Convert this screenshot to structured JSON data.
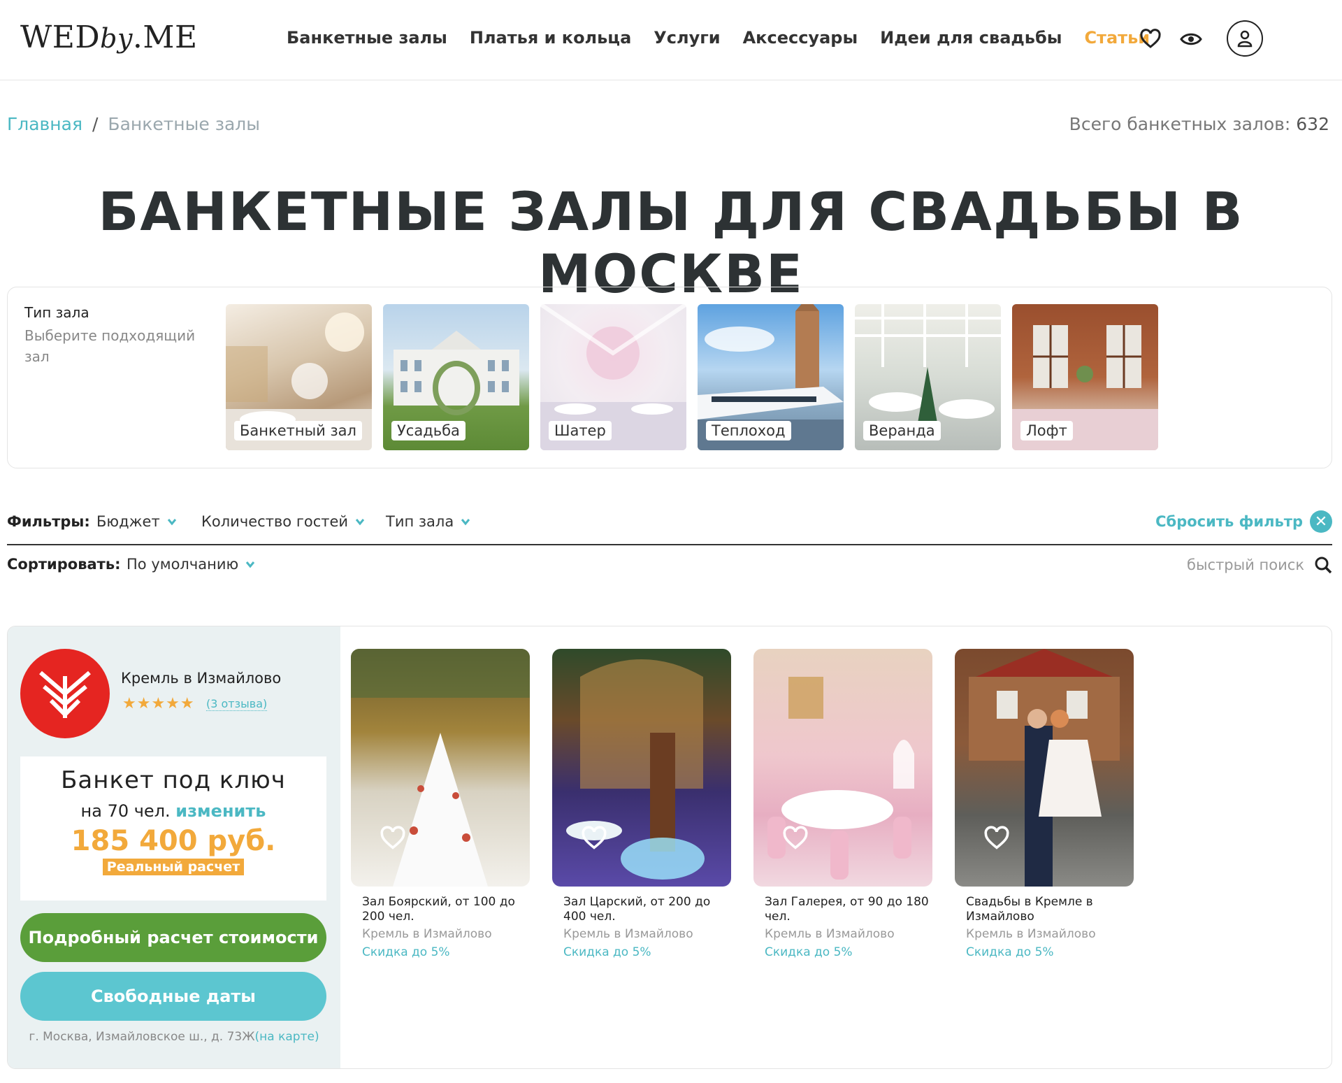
{
  "header": {
    "logo_left": "WED",
    "logo_by": "by",
    "logo_right": ".ME",
    "nav": [
      {
        "label": "Банкетные залы"
      },
      {
        "label": "Платья и кольца"
      },
      {
        "label": "Услуги"
      },
      {
        "label": "Аксессуары"
      },
      {
        "label": "Идеи для свадьбы"
      },
      {
        "label": "Статьи"
      }
    ]
  },
  "breadcrumb": {
    "home": "Главная",
    "separator": "/",
    "current": "Банкетные залы"
  },
  "total": {
    "label": "Всего банкетных залов:",
    "count": "632"
  },
  "page_title": "БАНКЕТНЫЕ ЗАЛЫ ДЛЯ СВАДЬБЫ В МОСКВЕ",
  "hall_type": {
    "title": "Тип зала",
    "subtitle": "Выберите подходящий зал",
    "tiles": [
      {
        "label": "Банкетный зал"
      },
      {
        "label": "Усадьба"
      },
      {
        "label": "Шатер"
      },
      {
        "label": "Теплоход"
      },
      {
        "label": "Веранда"
      },
      {
        "label": "Лофт"
      }
    ]
  },
  "filters": {
    "label": "Фильтры:",
    "items": [
      {
        "label": "Бюджет"
      },
      {
        "label": "Количество гостей"
      },
      {
        "label": "Тип зала"
      }
    ],
    "reset": "Сбросить фильтр"
  },
  "sort": {
    "label": "Сортировать:",
    "value": "По умолчанию",
    "search_placeholder": "быстрый поиск"
  },
  "venue": {
    "name": "Кремль в Измайлово",
    "stars": "★★★★★",
    "reviews": "(3 отзыва)",
    "banquet_title": "Банкет под ключ",
    "guests_prefix": "на 70 чел.",
    "change": "изменить",
    "price": "185 400 руб.",
    "real_calc": "Реальный расчет",
    "btn_details": "Подробный расчет стоимости",
    "btn_dates": "Свободные даты",
    "address": "г. Москва, Измайловское ш., д. 73Ж",
    "map_link": "(на карте)",
    "halls": [
      {
        "name": "Зал Боярский, от 100 до 200 чел.",
        "venue": "Кремль в Измайлово",
        "discount": "Скидка до 5%"
      },
      {
        "name": "Зал Царский, от 200 до 400 чел.",
        "venue": "Кремль в Измайлово",
        "discount": "Скидка до 5%"
      },
      {
        "name": "Зал Галерея, от 90 до 180 чел.",
        "venue": "Кремль в Измайлово",
        "discount": "Скидка до 5%"
      },
      {
        "name": "Свадьбы в Кремле в Измайлово",
        "venue": "Кремль в Измайлово",
        "discount": "Скидка до 5%"
      }
    ]
  },
  "colors": {
    "accent_teal": "#4bb8c3",
    "accent_orange": "#f2a93b",
    "green": "#5a9e3a",
    "brand_red": "#e52521"
  }
}
